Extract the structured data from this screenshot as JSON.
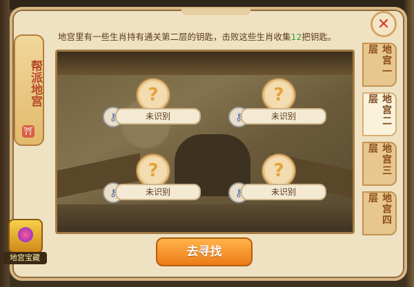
{
  "window": {
    "title": ""
  },
  "side_banner": {
    "title": "帮派地宫",
    "seal": "⛩"
  },
  "description": {
    "prefix": "地宫里有一些生肖持有通关第二层的钥匙，击败这些生肖收集",
    "count": "12",
    "suffix": "把钥匙。"
  },
  "slots": [
    {
      "label": "未识别",
      "icon": "question-icon",
      "key_icon": "key-icon"
    },
    {
      "label": "未识别",
      "icon": "question-icon",
      "key_icon": "key-icon"
    },
    {
      "label": "未识别",
      "icon": "question-icon",
      "key_icon": "key-icon"
    },
    {
      "label": "未识别",
      "icon": "question-icon",
      "key_icon": "key-icon"
    }
  ],
  "tabs": [
    {
      "label": "地宫一层",
      "active": false
    },
    {
      "label": "地宫二层",
      "active": true
    },
    {
      "label": "地宫三层",
      "active": false
    },
    {
      "label": "地宫四层",
      "active": false
    }
  ],
  "action": {
    "label": "去寻找"
  },
  "treasure": {
    "label": "地宫宝藏"
  },
  "colors": {
    "highlight": "#2f9f2f",
    "button": "#ec7b17",
    "close": "#d8392a"
  }
}
